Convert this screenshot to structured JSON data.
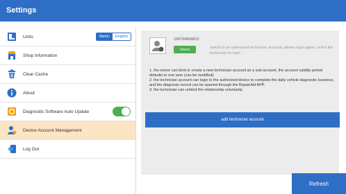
{
  "header": {
    "title": "Settings"
  },
  "sidebar": {
    "items": [
      {
        "label": "Units",
        "icon": "ruler-icon"
      },
      {
        "label": "Shop Information",
        "icon": "shop-icon"
      },
      {
        "label": "Clear Cache",
        "icon": "trash-icon"
      },
      {
        "label": "About",
        "icon": "info-icon"
      },
      {
        "label": "Diagnostic Software Auto Update",
        "icon": "update-icon"
      },
      {
        "label": "Device Account Management",
        "icon": "user-account-icon"
      },
      {
        "label": "Log Out",
        "icon": "logout-icon"
      }
    ],
    "units_options": {
      "metric": "Metric",
      "english": "English"
    },
    "auto_update_enabled": true
  },
  "account": {
    "id": "100704000812",
    "role_badge": "Owner",
    "switch_hint": "switch to an authorized technician account, please login again, select the technician to login",
    "rules": [
      "1. the owner can bind or create a new technician account as a sub-account, the account validity period defaults to one year (can be modified).",
      "2. the technician account can login to the authorized device to complete the daily vehicle diagnostic business, and the diagnosis record can be queried through the RepairAid APP.",
      "3. the technician can unbind the relationship voluntarily."
    ],
    "add_button": "add technician account"
  },
  "footer": {
    "refresh_label": "Refresh"
  },
  "colors": {
    "brand_blue": "#2e6ec5",
    "active_row": "#fbe5c4",
    "green": "#4caf50"
  }
}
